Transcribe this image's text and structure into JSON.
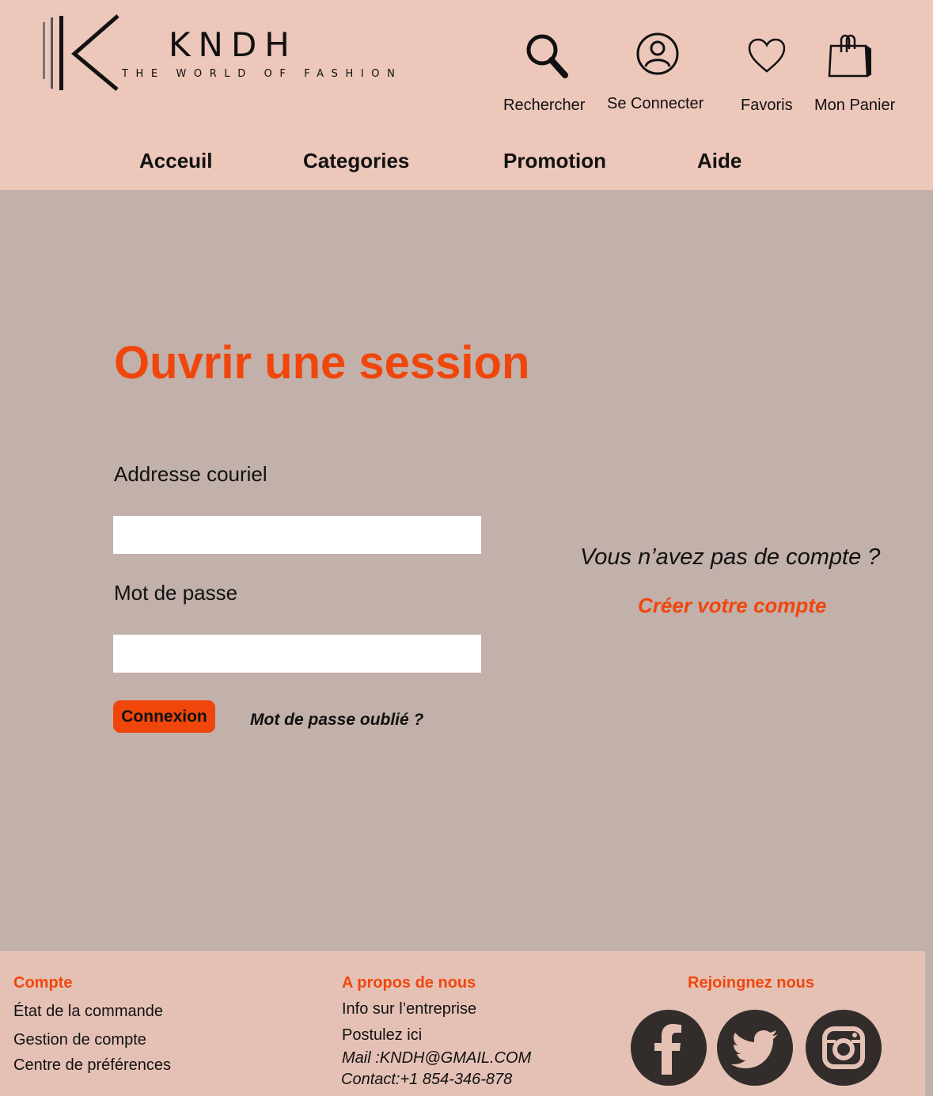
{
  "brand": {
    "name": "KNDH",
    "tagline": "THE WORLD OF FASHION"
  },
  "header": {
    "icons": [
      {
        "icon": "search-icon",
        "label": "Rechercher"
      },
      {
        "icon": "user-icon",
        "label": "Se Connecter"
      },
      {
        "icon": "heart-icon",
        "label": "Favoris"
      },
      {
        "icon": "shopping-bag-icon",
        "label": "Mon Panier"
      }
    ],
    "nav": [
      "Acceuil",
      "Categories",
      "Promotion",
      "Aide"
    ]
  },
  "login": {
    "title": "Ouvrir une session",
    "email_label": "Addresse couriel",
    "email_value": "",
    "password_label": "Mot de passe",
    "password_value": "",
    "submit_label": "Connexion",
    "forgot_label": "Mot de passe oublié ?"
  },
  "signup": {
    "prompt": "Vous n’avez pas de compte ?",
    "link": "Créer votre compte"
  },
  "footer": {
    "account": {
      "heading": "Compte",
      "links": [
        "État de la commande",
        "Gestion de compte",
        "Centre de préférences"
      ]
    },
    "about": {
      "heading": "A propos de nous",
      "links": [
        "Info sur l’entreprise",
        "Postulez ici"
      ],
      "mail": "Mail :KNDH@GMAIL.COM",
      "contact": "Contact:+1 854-346-878"
    },
    "social": {
      "heading": "Rejoingnez nous",
      "icons": [
        "facebook-icon",
        "twitter-icon",
        "instagram-icon"
      ]
    }
  },
  "colors": {
    "header_bg": "#ecc7ba",
    "main_bg": "#c2b0aa",
    "footer_bg": "#e5c1b5",
    "accent": "#f0460c",
    "social_bg": "#322d2b"
  }
}
